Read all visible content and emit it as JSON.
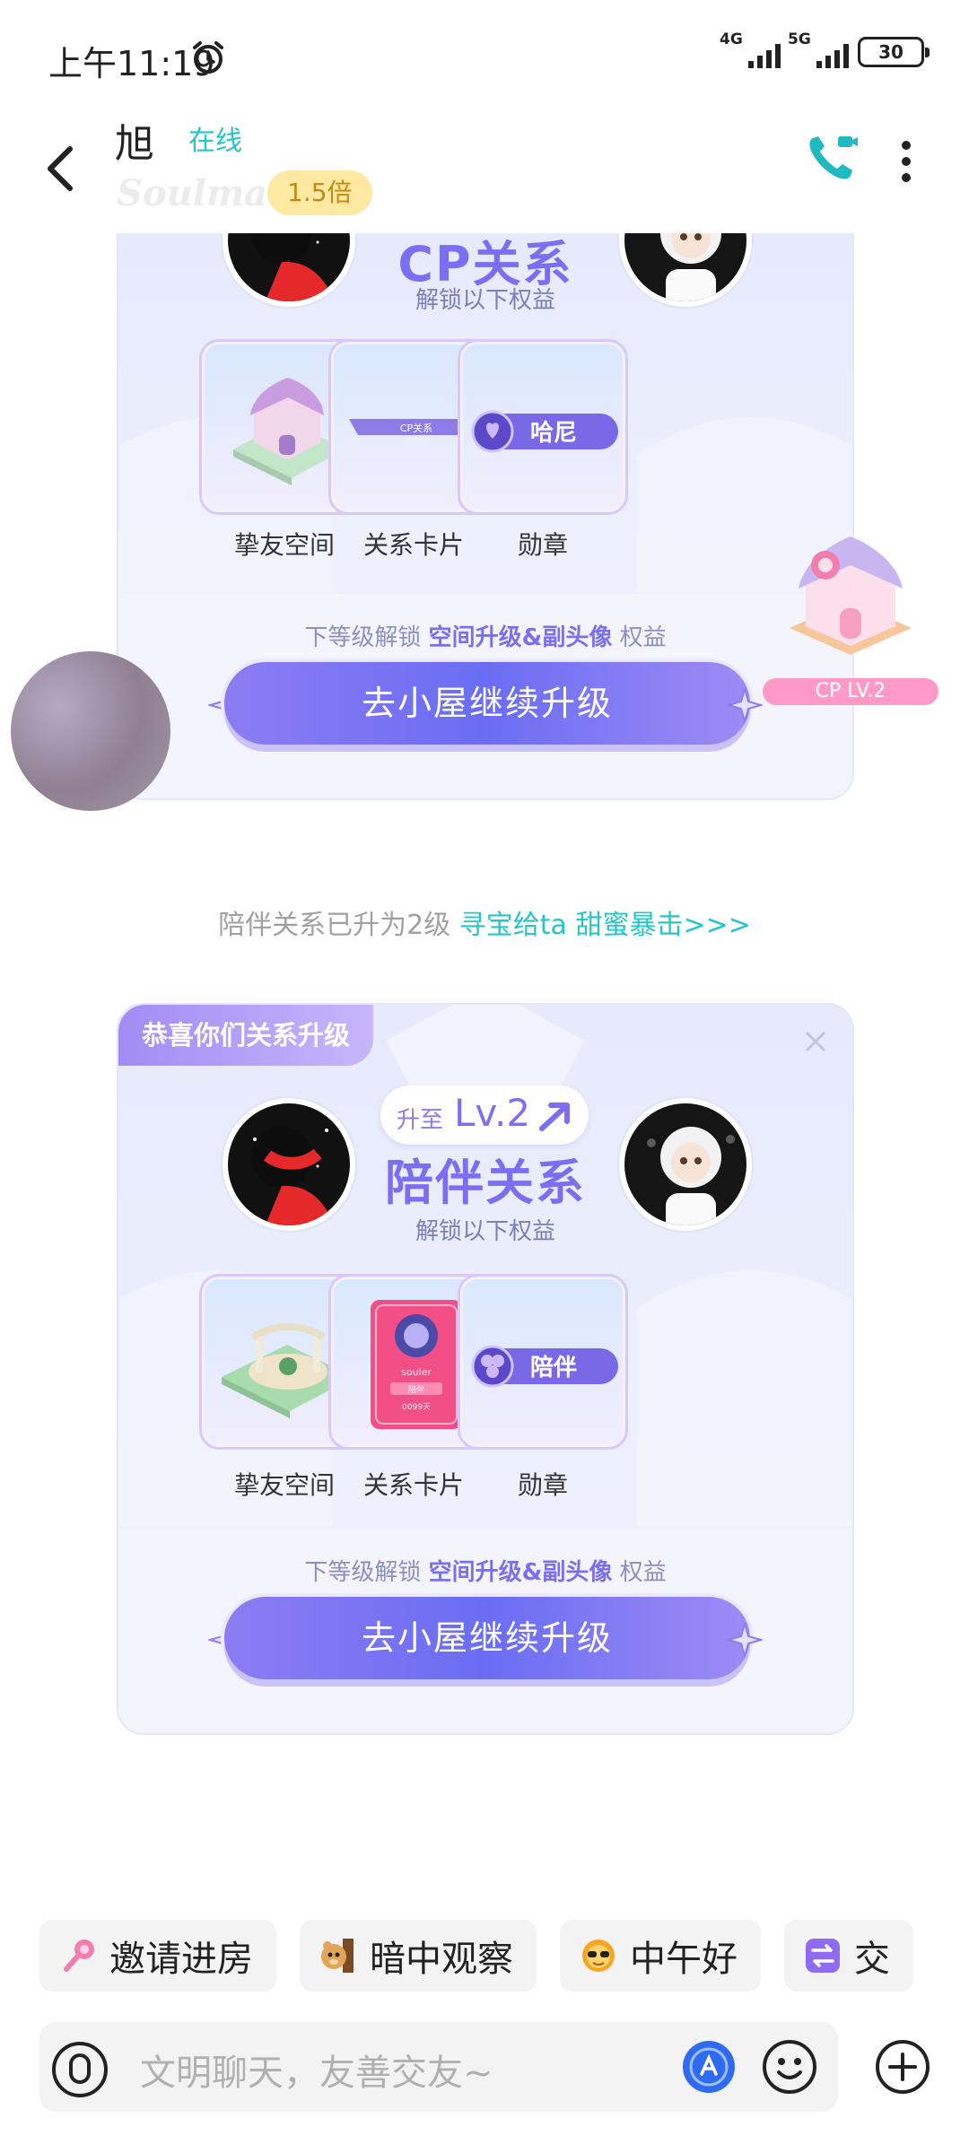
{
  "status": {
    "time": "上午11:19",
    "net1": "4G",
    "net2": "5G",
    "battery": "30"
  },
  "header": {
    "name": "旭",
    "online": "在线",
    "brand": "Soulmate",
    "multiplier": "1.5倍"
  },
  "card1": {
    "title": "CP关系",
    "subtitle": "解锁以下权益",
    "tiles": [
      {
        "label": "挚友空间"
      },
      {
        "label": "关系卡片",
        "inner": "CP关系"
      },
      {
        "label": "勋章",
        "inner": "哈尼"
      }
    ],
    "hint_prefix": "下等级解锁",
    "hint_bold": "空间升级&副头像",
    "hint_suffix": "权益",
    "cta": "去小屋继续升级"
  },
  "side": {
    "cp_badge": "CP LV.2"
  },
  "system": {
    "text": "陪伴关系已升为2级",
    "link": "寻宝给ta 甜蜜暴击>>>"
  },
  "card2": {
    "corner": "恭喜你们关系升级",
    "lv_prefix": "升至",
    "lv": "Lv.2",
    "title": "陪伴关系",
    "subtitle": "解锁以下权益",
    "tiles": [
      {
        "label": "挚友空间"
      },
      {
        "label": "关系卡片",
        "inner_a": "souler",
        "inner_b": "陪伴",
        "inner_c": "0099天"
      },
      {
        "label": "勋章",
        "inner": "陪伴"
      }
    ],
    "hint_prefix": "下等级解锁",
    "hint_bold": "空间升级&副头像",
    "hint_suffix": "权益",
    "cta": "去小屋继续升级"
  },
  "quick_replies": [
    {
      "label": "邀请进房",
      "icon": "microphone-icon",
      "color": "#f07fb0"
    },
    {
      "label": "暗中观察",
      "icon": "peeking-bear-icon",
      "color": "#e2a458"
    },
    {
      "label": "中午好",
      "icon": "sun-sunglasses-icon",
      "color": "#f6a623"
    },
    {
      "label": "交",
      "icon": "swap-icon",
      "color": "#8e6bf0"
    }
  ],
  "input": {
    "placeholder": "文明聊天，友善交友~"
  }
}
